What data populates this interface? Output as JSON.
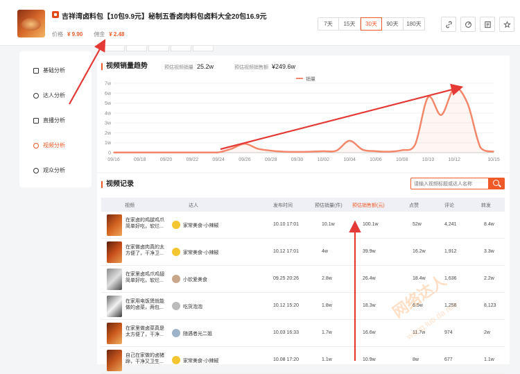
{
  "product": {
    "title": "吉祥湾卤料包【10包9.9元】秘制五香卤肉料包卤料大全20包16.9元",
    "price_label": "价格",
    "price_value": "¥ 9.90",
    "commission_label": "佣金",
    "commission_value": "¥ 2.48"
  },
  "date_ranges": [
    {
      "label": "7天",
      "active": false
    },
    {
      "label": "15天",
      "active": false
    },
    {
      "label": "30天",
      "active": true
    },
    {
      "label": "90天",
      "active": false
    },
    {
      "label": "180天",
      "active": false
    }
  ],
  "toolbar": {
    "icons": [
      "link-icon",
      "share-icon",
      "qrcode-icon",
      "favorite-icon"
    ]
  },
  "sidebar": {
    "items": [
      {
        "label": "基础分析",
        "icon": "chart-icon",
        "active": false
      },
      {
        "label": "达人分析",
        "icon": "user-icon",
        "active": false
      },
      {
        "label": "直播分析",
        "icon": "live-icon",
        "active": false
      },
      {
        "label": "视频分析",
        "icon": "video-icon",
        "active": true
      },
      {
        "label": "观众分析",
        "icon": "audience-icon",
        "active": false
      }
    ]
  },
  "trend": {
    "title": "视频销量趋势",
    "est_sales_label": "预估视频销量",
    "est_sales_value": "25.2w",
    "est_amount_label": "预估视频销售额",
    "est_amount_value": "¥249.6w",
    "legend": "销量"
  },
  "chart_data": {
    "type": "line",
    "x_ticks": [
      "09/16",
      "09/18",
      "09/20",
      "09/22",
      "09/24",
      "09/26",
      "09/28",
      "09/30",
      "10/02",
      "10/04",
      "10/06",
      "10/08",
      "10/10",
      "10/12",
      "10/15"
    ],
    "y_ticks": [
      "0",
      "1w",
      "2w",
      "3w",
      "4w",
      "5w",
      "6w",
      "7w"
    ],
    "ylim": [
      0,
      70000
    ],
    "x": [
      "09/16",
      "09/17",
      "09/18",
      "09/19",
      "09/20",
      "09/21",
      "09/22",
      "09/23",
      "09/24",
      "09/25",
      "09/26",
      "09/27",
      "09/28",
      "09/29",
      "09/30",
      "10/01",
      "10/02",
      "10/03",
      "10/04",
      "10/05",
      "10/06",
      "10/07",
      "10/08",
      "10/09",
      "10/10",
      "10/11",
      "10/12",
      "10/13",
      "10/14",
      "10/15"
    ],
    "series": [
      {
        "name": "销量",
        "values": [
          200,
          200,
          200,
          200,
          200,
          200,
          200,
          200,
          300,
          4000,
          9000,
          4000,
          2000,
          1000,
          800,
          1000,
          1500,
          2000,
          12000,
          3000,
          1500,
          1000,
          2500,
          8000,
          56000,
          38000,
          65000,
          50000,
          5000,
          1000
        ]
      }
    ],
    "color": "#f4866a"
  },
  "records": {
    "title": "视频记录",
    "search_placeholder": "请输入视频标题或达人名称",
    "headers": [
      "视频",
      "达人",
      "发布时间",
      "预估销量(件)",
      "预估销售额(元)",
      "点赞",
      "评论",
      "转发"
    ],
    "rows": [
      {
        "title": "在家卤的鸡腿鸡爪简单好吃，软烂...",
        "creator": "家常美食-小辣椒",
        "time": "10.10 17:01",
        "sales": "10.1w",
        "amount": "100.1w",
        "likes": "52w",
        "comments": "4,241",
        "shares": "8.4w"
      },
      {
        "title": "在家做卤肉真的太方便了，干净卫...",
        "creator": "家常美食-小辣椒",
        "time": "10.12 17:01",
        "sales": "4w",
        "amount": "39.9w",
        "likes": "16.2w",
        "comments": "1,912",
        "shares": "3.3w"
      },
      {
        "title": "在家里卤鸡爪鸡翅简单好吃，软烂...",
        "creator": "小钦爱美食",
        "time": "09.25 20:26",
        "sales": "2.8w",
        "amount": "26.4w",
        "likes": "18.4w",
        "comments": "1,636",
        "shares": "2.2w"
      },
      {
        "title": "在家用电饭煲就能做的卤菜，两包...",
        "creator": "吃货泡泡",
        "time": "10.12 15:20",
        "sales": "1.8w",
        "amount": "18.3w",
        "likes": "6.5w",
        "comments": "1,258",
        "shares": "8,123"
      },
      {
        "title": "在家里做卤菜真是太方便了，干净...",
        "creator": "随遇者光二姐",
        "time": "10.03 16:33",
        "sales": "1.7w",
        "amount": "16.6w",
        "likes": "11.7w",
        "comments": "974",
        "shares": "2w"
      },
      {
        "title": "自己在家做的卤猪蹄，干净又卫生...",
        "creator": "家常美食-小辣椒",
        "time": "10.08 17:20",
        "sales": "1.1w",
        "amount": "10.9w",
        "likes": "8w",
        "comments": "677",
        "shares": "1.1w"
      }
    ]
  },
  "watermark": {
    "text": "网络达人",
    "sub": "wang luo da ren"
  },
  "colors": {
    "accent": "#f05a28",
    "line": "#f4866a",
    "arrow": "#e53935"
  }
}
